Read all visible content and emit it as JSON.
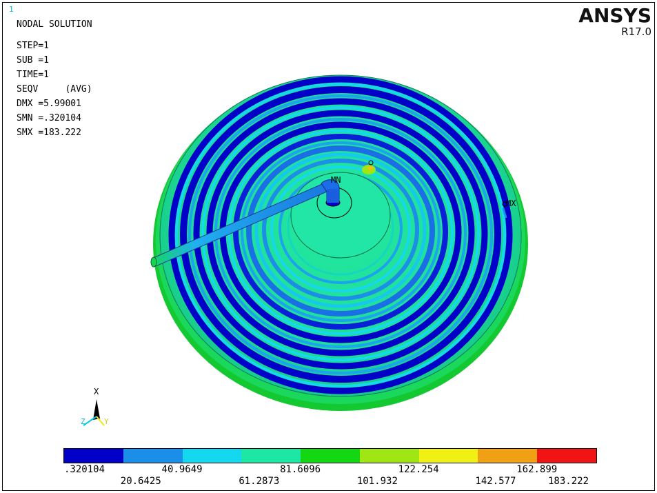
{
  "window": {
    "number": "1"
  },
  "info": {
    "title": "NODAL SOLUTION",
    "step": "STEP=1",
    "sub": "SUB =1",
    "time": "TIME=1",
    "result": "SEQV     (AVG)",
    "dmx": "DMX =5.99001",
    "smn": "SMN =.320104",
    "smx": "SMX =183.222"
  },
  "brand": {
    "name": "ANSYS",
    "version": "R17.0"
  },
  "model": {
    "min_marker": "MN",
    "max_marker": "MX",
    "colors": {
      "blue": "#0000c8",
      "mid_blue": "#1f8fe8",
      "cyan": "#14e6f0",
      "teal": "#1ee6a0",
      "green": "#14e628"
    }
  },
  "triad": {
    "x_label": "X",
    "y_label": "Y",
    "z_label": "Z"
  },
  "legend": {
    "colors": [
      "#0000c8",
      "#1b8ee8",
      "#14d7f0",
      "#1ee6a5",
      "#14d714",
      "#a0e614",
      "#f0f014",
      "#f0a014",
      "#f01414"
    ],
    "values_top": [
      ".320104",
      "40.9649",
      "81.6096",
      "122.254",
      "162.899"
    ],
    "values_bottom": [
      "20.6425",
      "61.2873",
      "101.932",
      "142.577",
      "183.222"
    ]
  }
}
